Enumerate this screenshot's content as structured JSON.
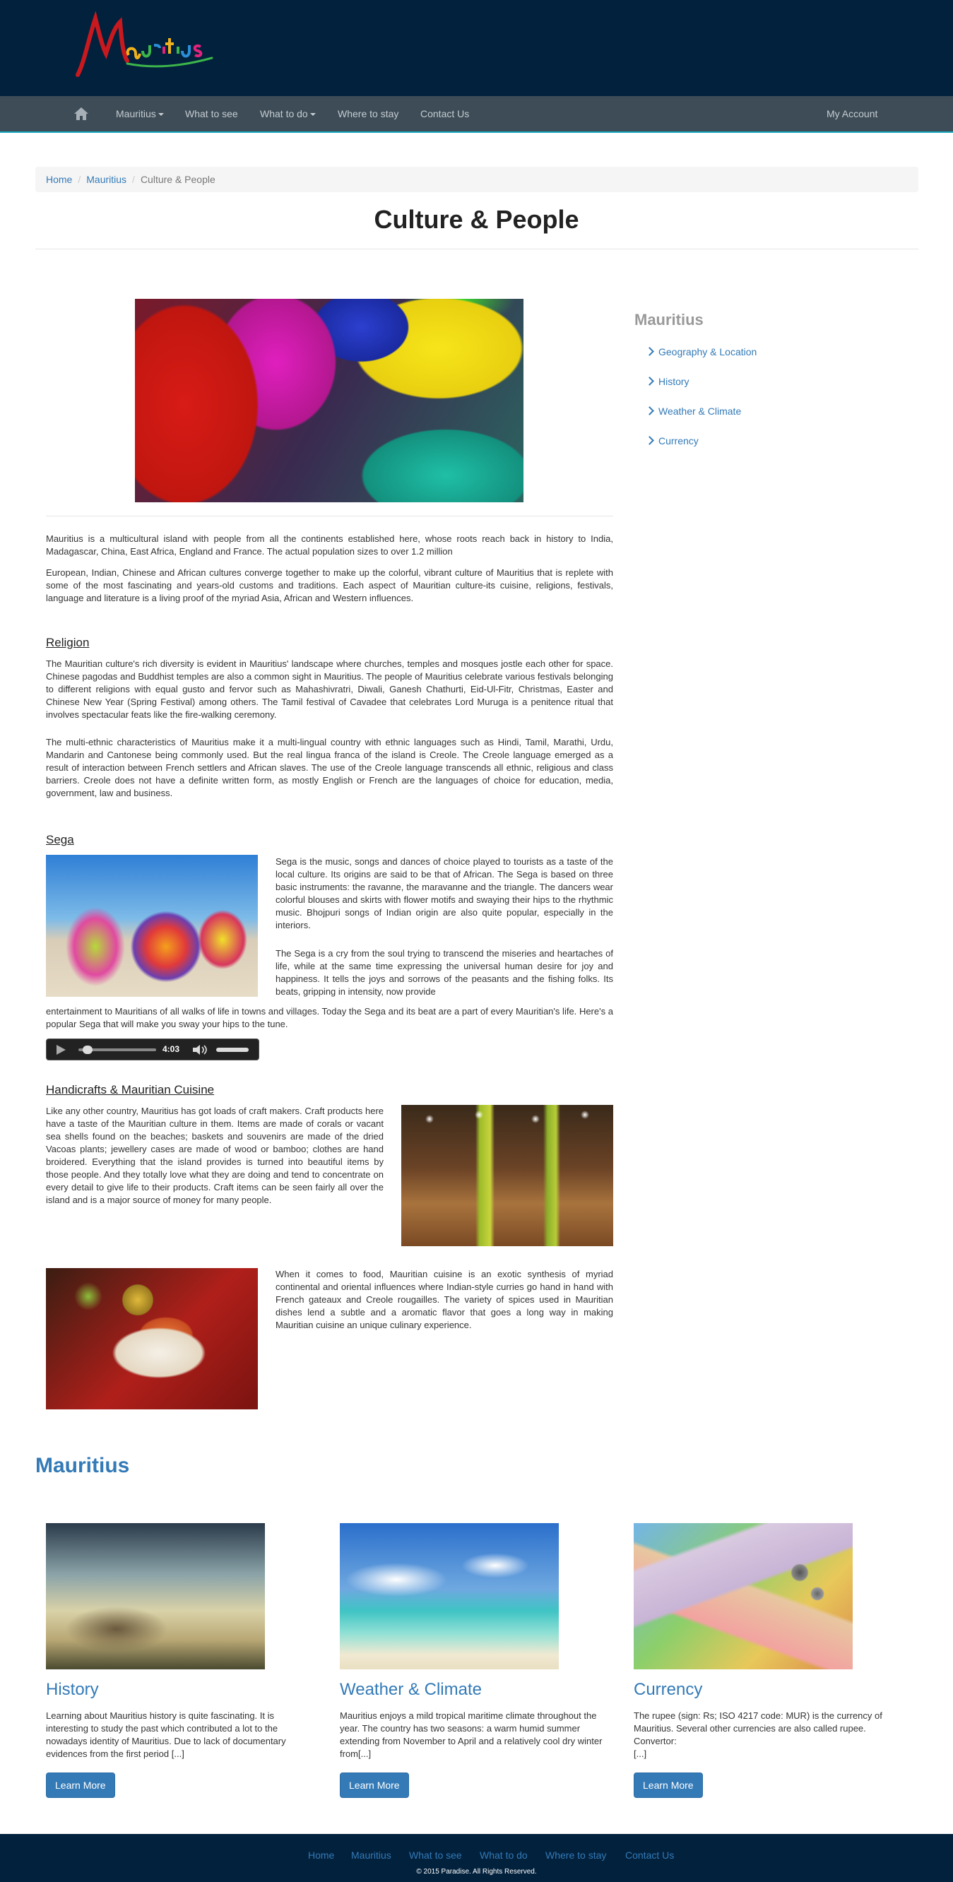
{
  "brand": {
    "logo_text": "Mauritius"
  },
  "nav": {
    "home_icon": "home-icon",
    "items": [
      {
        "label": "Mauritius",
        "dropdown": true
      },
      {
        "label": "What to see",
        "dropdown": false
      },
      {
        "label": "What to do",
        "dropdown": true
      },
      {
        "label": "Where to stay",
        "dropdown": false
      },
      {
        "label": "Contact Us",
        "dropdown": false
      }
    ],
    "account": "My Account"
  },
  "breadcrumb": {
    "home": "Home",
    "parent": "Mauritius",
    "current": "Culture & People"
  },
  "page": {
    "title": "Culture & People"
  },
  "intro": {
    "p1": "Mauritius is a multicultural island with people from all the continents established here, whose roots reach back in history to India, Madagascar, China, East Africa, England and France. The actual population sizes to over 1.2 million",
    "p2": "European, Indian, Chinese and African cultures converge together to make up the colorful, vibrant culture of Mauritius that is replete with some of the most fascinating and years-old customs and traditions. Each aspect of Mauritian culture-its cuisine, religions, festivals, language and literature is a living proof of the myriad Asia, African and Western influences."
  },
  "religion": {
    "heading": "Religion",
    "p1": "The Mauritian culture's rich diversity is evident in Mauritius' landscape where churches, temples and mosques jostle each other for space. Chinese pagodas and Buddhist temples are also a common sight in Mauritius. The people of Mauritius celebrate various festivals belonging to different religions with equal gusto and fervor such as Mahashivratri, Diwali, Ganesh Chathurti, Eid-Ul-Fitr, Christmas, Easter and Chinese New Year (Spring Festival) among others. The Tamil festival of Cavadee that celebrates Lord Muruga is a penitence ritual that involves spectacular feats like the fire-walking ceremony.",
    "p2": "The multi-ethnic characteristics of Mauritius make it a multi-lingual country with ethnic languages such as Hindi, Tamil, Marathi, Urdu, Mandarin and Cantonese being commonly used. But the real lingua franca of the island is Creole. The Creole language emerged as a result of interaction between French settlers and African slaves. The use of the Creole language transcends all ethnic, religious and class barriers. Creole does not have a definite written form, as mostly English or French are the languages of choice for education, media, government, law and business."
  },
  "sega": {
    "heading": "Sega",
    "p1": "Sega is the music, songs and dances of choice played to tourists as a taste of the local culture. Its origins are said to be that of African. The Sega is based on three basic instruments: the ravanne, the maravanne and the triangle. The dancers wear colorful blouses and skirts with flower motifs and swaying their hips to the rhythmic music. Bhojpuri songs of Indian origin are also quite popular, especially in the interiors.",
    "p2a": "The Sega is a cry from the soul trying to transcend the miseries and heartaches of life, while at the same time expressing the universal human desire for joy and happiness. It tells the joys and sorrows of the peasants and the fishing folks. Its beats, gripping in intensity, now provide",
    "p2b": "entertainment to Mauritians of all walks of life in towns and villages. Today the Sega and its beat are a part of every Mauritian's life. Here's a popular Sega that will make you sway your hips to the tune.",
    "audio_time": "4:03",
    "audio_progress": 0.05
  },
  "crafts": {
    "heading": "Handicrafts & Mauritian Cuisine",
    "p1": "Like any other country, Mauritius has got loads of craft makers. Craft products here have a taste of the Mauritian culture in them. Items are made of corals or vacant sea shells found on the beaches; baskets and souvenirs are made of the dried Vacoas plants; jewellery cases are made of wood or bamboo; clothes are hand broidered. Everything that the island provides is turned into beautiful items by those people. And they totally love what they are doing and tend to concentrate on every detail to give life to their products. Craft items can be seen fairly all over the island and is a major source of money for many people.",
    "p2": "When it comes to food, Mauritian cuisine is an exotic synthesis of myriad continental and oriental influences where Indian-style curries go hand in hand with French gateaux and Creole rougailles. The variety of spices used in Mauritian dishes lend a subtle and a aromatic flavor that goes a long way in making Mauritian cuisine an unique culinary experience."
  },
  "sidebar": {
    "title": "Mauritius",
    "links": [
      "Geography & Location",
      "History",
      "Weather & Climate",
      "Currency"
    ]
  },
  "section2": {
    "heading": "Mauritius",
    "cards": [
      {
        "title": "History",
        "text": "Learning about Mauritius history is quite fascinating. It is interesting to study the past which contributed a lot to the nowadays identity of Mauritius. Due to lack of documentary evidences from the first period [...]",
        "button": "Learn More"
      },
      {
        "title": "Weather & Climate",
        "text": "Mauritius enjoys a mild tropical maritime climate throughout the year. The country has two seasons: a warm humid summer extending from November to April and a relatively cool dry winter from[...]",
        "button": "Learn More"
      },
      {
        "title": "Currency",
        "text": "The rupee (sign: Rs; ISO 4217 code: MUR) is the currency of Mauritius. Several other currencies are also called rupee. Convertor:",
        "text2": "[...]",
        "button": "Learn More"
      }
    ]
  },
  "footer": {
    "links": [
      "Home",
      "Mauritius",
      "What to see",
      "What to do",
      "Where to stay",
      "Contact Us"
    ],
    "copyright": "© 2015 Paradise. All Rights Reserved."
  },
  "colors": {
    "header_bg": "#02213d",
    "nav_bg": "#3d4c57",
    "link": "#337ab7",
    "accent": "#16a7bd"
  }
}
